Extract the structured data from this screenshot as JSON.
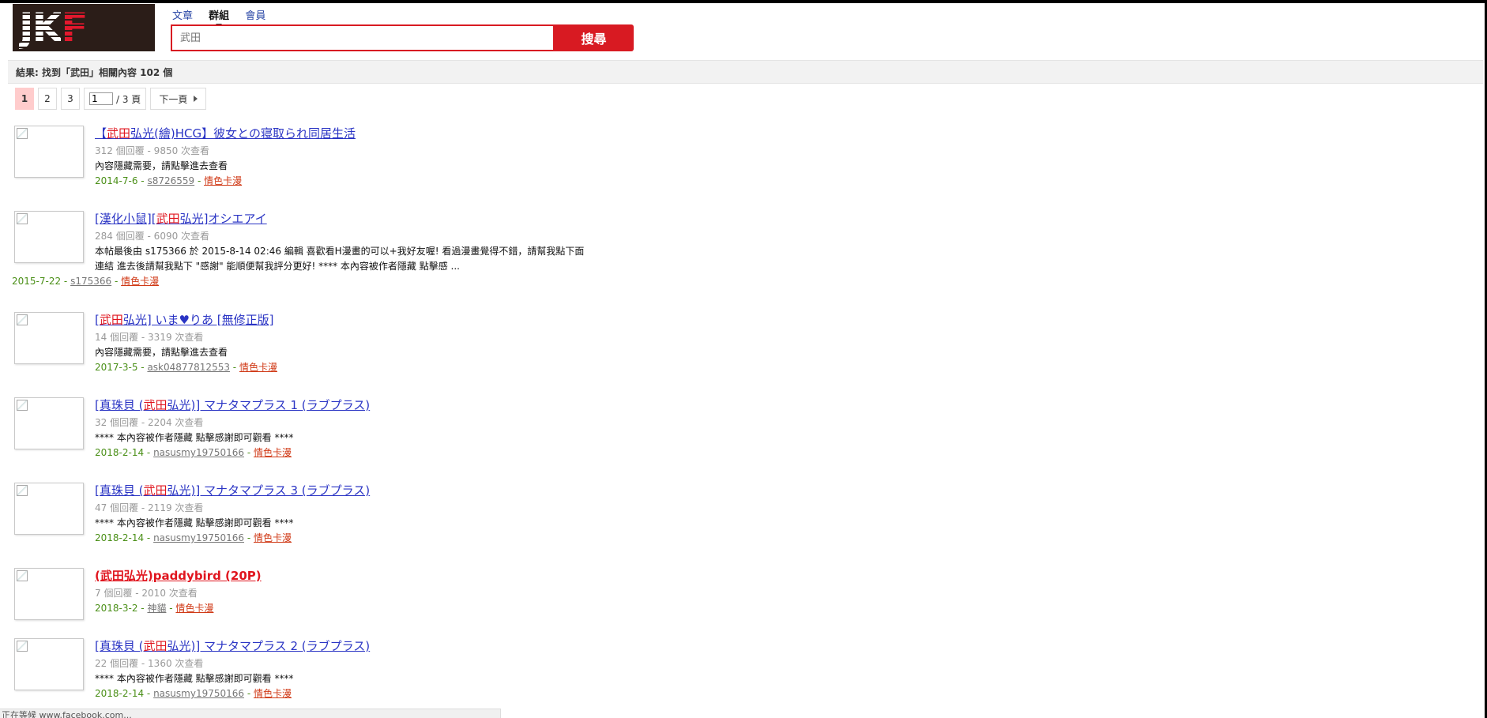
{
  "header": {
    "logo_main": "JK",
    "logo_accent": "F",
    "nav": [
      {
        "label": "文章",
        "active": false
      },
      {
        "label": "群組",
        "active": true
      },
      {
        "label": "會員",
        "active": false
      }
    ],
    "search_placeholder": "武田",
    "search_button": "搜尋"
  },
  "result_summary": "結果: 找到「武田」相關內容 102 個",
  "pager": {
    "pages": [
      "1",
      "2",
      "3"
    ],
    "current": "1",
    "jump_value": "1",
    "total_label": "/ 3 頁",
    "next_label": "下一頁"
  },
  "results": [
    {
      "title_parts": [
        [
          "【",
          false
        ],
        [
          "武田",
          true
        ],
        [
          "弘光(繪)HCG】彼女との寝取られ同居生活",
          false
        ]
      ],
      "meta": "312 個回覆 - 9850 次查看",
      "desc": [
        "內容隱藏需要，請點擊進去查看"
      ],
      "date": "2014-7-6",
      "user": "s8726559",
      "category": "情色卡漫"
    },
    {
      "title_parts": [
        [
          "[漢化小鼠][",
          false
        ],
        [
          "武田",
          true
        ],
        [
          "弘光]オシエアイ",
          false
        ]
      ],
      "meta": "284 個回覆 - 6090 次查看",
      "desc": [
        "本帖最後由 s175366 於 2015-8-14 02:46 編輯 喜歡看H漫畫的可以+我好友喔! 看過漫畫覺得不錯，請幫我點下面",
        "連結 進去後請幫我點下 \"感謝\" 能順便幫我評分更好! **** 本內容被作者隱藏 點擊感 ..."
      ],
      "date": "2015-7-22",
      "user": "s175366",
      "category": "情色卡漫"
    },
    {
      "title_parts": [
        [
          "[",
          false
        ],
        [
          "武田",
          true
        ],
        [
          "弘光] いま♥りあ [無修正版]",
          false
        ]
      ],
      "meta": "14 個回覆 - 3319 次查看",
      "desc": [
        "內容隱藏需要，請點擊進去查看"
      ],
      "date": "2017-3-5",
      "user": "ask04877812553",
      "category": "情色卡漫"
    },
    {
      "title_parts": [
        [
          "[真珠貝 (",
          false
        ],
        [
          "武田",
          true
        ],
        [
          "弘光)] マナタマプラス 1 (ラブプラス)",
          false
        ]
      ],
      "meta": "32 個回覆 - 2204 次查看",
      "desc": [
        "**** 本內容被作者隱藏 點擊感謝即可觀看 ****"
      ],
      "date": "2018-2-14",
      "user": "nasusmy19750166",
      "category": "情色卡漫"
    },
    {
      "title_parts": [
        [
          "[真珠貝 (",
          false
        ],
        [
          "武田",
          true
        ],
        [
          "弘光)] マナタマプラス 3 (ラブプラス)",
          false
        ]
      ],
      "meta": "47 個回覆 - 2119 次查看",
      "desc": [
        "**** 本內容被作者隱藏 點擊感謝即可觀看 ****"
      ],
      "date": "2018-2-14",
      "user": "nasusmy19750166",
      "category": "情色卡漫"
    },
    {
      "title_parts": [
        [
          "(武田弘光)paddybird (20P)",
          false
        ]
      ],
      "title_red": true,
      "meta": "7 個回覆 - 2010 次查看",
      "desc": [],
      "date": "2018-3-2",
      "user": "神貓",
      "category": "情色卡漫"
    },
    {
      "title_parts": [
        [
          "[真珠貝 (",
          false
        ],
        [
          "武田",
          true
        ],
        [
          "弘光)] マナタマプラス 2 (ラブプラス)",
          false
        ]
      ],
      "meta": "22 個回覆 - 1360 次查看",
      "desc": [
        "**** 本內容被作者隱藏 點擊感謝即可觀看 ****"
      ],
      "date": "2018-2-14",
      "user": "nasusmy19750166",
      "category": "情色卡漫"
    }
  ],
  "status_bar": "正在等候 www.facebook.com..."
}
